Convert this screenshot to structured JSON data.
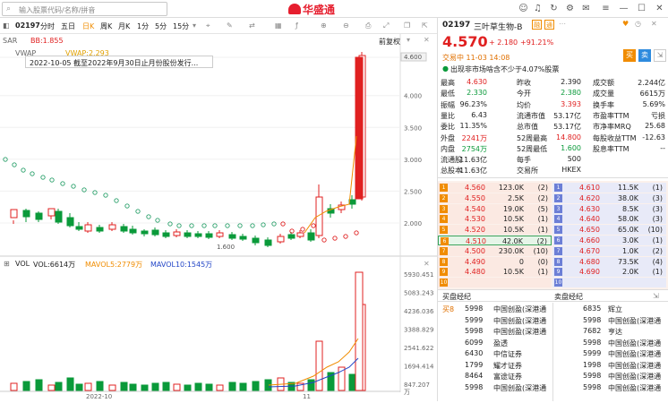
{
  "search": {
    "placeholder": "输入股票代码/名称/拼音"
  },
  "logo": {
    "text": "华盛通"
  },
  "tabs": {
    "code": "02197",
    "items": [
      "分时",
      "五日",
      "日K",
      "周K",
      "月K",
      "1分",
      "5分",
      "15分"
    ],
    "active": "日K",
    "adjust": "前复权"
  },
  "indicators": {
    "sar": "SAR",
    "bb": "BB:1.855",
    "vwap": "VWAP",
    "vwap_val": "VWAP:2.293"
  },
  "tooltip": "2022-10-05 截至2022年9月30日止月份股份发行...",
  "price_axis": {
    "labels": [
      "4.600",
      "4.000",
      "3.500",
      "3.000",
      "2.500",
      "2.000"
    ],
    "min_label": "1.600",
    "current": "4.600"
  },
  "vol_header": {
    "vol": "VOL",
    "vol_val": "VOL:6614万",
    "ma5": "MAVOL5:2779万",
    "ma10": "MAVOL10:1545万"
  },
  "vol_axis": {
    "labels": [
      "5930.451",
      "5083.243",
      "4236.036",
      "3388.829",
      "2541.622",
      "1694.414",
      "847.207",
      "万"
    ]
  },
  "date_axis": [
    "2022-10",
    "11"
  ],
  "stock": {
    "code": "02197",
    "name": "三叶草生物-B",
    "price": "4.570",
    "change": "+ 2.180",
    "pct": "+91.21%",
    "time": "交易中 11-03 14:08",
    "notice": "出现非市场啥含不少于4.07%股票"
  },
  "colors": {
    "up": "#e02020",
    "down": "#0a9a3a",
    "accent": "#f08c00",
    "blue": "#2346c7"
  },
  "fin": [
    [
      [
        "最高",
        "4.630",
        "red"
      ],
      [
        "昨收",
        "2.390",
        ""
      ],
      [
        "成交额",
        "2.244亿",
        ""
      ]
    ],
    [
      [
        "最低",
        "2.330",
        "green"
      ],
      [
        "今开",
        "2.380",
        "green"
      ],
      [
        "成交量",
        "6615万",
        ""
      ]
    ],
    [
      [
        "振幅",
        "96.23%",
        ""
      ],
      [
        "均价",
        "3.393",
        "red"
      ],
      [
        "换手率",
        "5.69%",
        ""
      ]
    ],
    [
      [
        "量比",
        "6.43",
        ""
      ],
      [
        "流通市值",
        "53.17亿",
        ""
      ],
      [
        "市盈率TTM",
        "亏损",
        ""
      ]
    ],
    [
      [
        "委比",
        "11.35%",
        ""
      ],
      [
        "总市值",
        "53.17亿",
        ""
      ],
      [
        "市净率MRQ",
        "25.68",
        ""
      ]
    ],
    [
      [
        "外盘",
        "2241万",
        "red"
      ],
      [
        "52周最高",
        "14.800",
        "red"
      ],
      [
        "每股收益TTM",
        "-12.63",
        ""
      ]
    ],
    [
      [
        "内盘",
        "2754万",
        "green"
      ],
      [
        "52周最低",
        "1.600",
        "green"
      ],
      [
        "股息率TTM",
        "--",
        ""
      ]
    ],
    [
      [
        "流通股",
        "11.63亿",
        ""
      ],
      [
        "每手",
        "500",
        ""
      ],
      [
        "",
        ""
      ]
    ],
    [
      [
        "总股本",
        "11.63亿",
        ""
      ],
      [
        "交易所",
        "HKEX",
        ""
      ],
      [
        "",
        ""
      ]
    ]
  ],
  "bids": [
    [
      "1",
      "4.560",
      "123.0K",
      "(2)"
    ],
    [
      "2",
      "4.550",
      "2.5K",
      "(2)"
    ],
    [
      "3",
      "4.540",
      "19.0K",
      "(5)"
    ],
    [
      "4",
      "4.530",
      "10.5K",
      "(1)"
    ],
    [
      "5",
      "4.520",
      "10.5K",
      "(1)"
    ],
    [
      "6",
      "4.510",
      "42.0K",
      "(2)"
    ],
    [
      "7",
      "4.500",
      "230.0K",
      "(10)"
    ],
    [
      "8",
      "4.490",
      "0",
      "(0)"
    ],
    [
      "9",
      "4.480",
      "10.5K",
      "(1)"
    ],
    [
      "10",
      "",
      "",
      " "
    ]
  ],
  "asks": [
    [
      "1",
      "4.610",
      "11.5K",
      "(1)"
    ],
    [
      "2",
      "4.620",
      "38.0K",
      "(3)"
    ],
    [
      "3",
      "4.630",
      "8.5K",
      "(3)"
    ],
    [
      "4",
      "4.640",
      "58.0K",
      "(3)"
    ],
    [
      "5",
      "4.650",
      "65.0K",
      "(10)"
    ],
    [
      "6",
      "4.660",
      "3.0K",
      "(1)"
    ],
    [
      "7",
      "4.670",
      "1.0K",
      "(2)"
    ],
    [
      "8",
      "4.680",
      "73.5K",
      "(4)"
    ],
    [
      "9",
      "4.690",
      "2.0K",
      "(1)"
    ],
    [
      "10",
      "",
      "",
      ""
    ]
  ],
  "brokers": {
    "buy_title": "买盘经纪",
    "sell_title": "卖盘经纪",
    "buy_label": "买8",
    "buy": [
      [
        "5998",
        "中国创盈(深港通"
      ],
      [
        "5999",
        "中国创盈(深港通"
      ],
      [
        "5998",
        "中国创盈(深港通"
      ],
      [
        "6099",
        "盈透"
      ],
      [
        "6430",
        "中信证券"
      ],
      [
        "1799",
        "耀才证券"
      ],
      [
        "8464",
        "富途证券"
      ],
      [
        "5998",
        "中国创盈(深港通"
      ]
    ],
    "sell": [
      [
        "6835",
        "辉立"
      ],
      [
        "5998",
        "中国创盈(深港通"
      ],
      [
        "7682",
        "亨达"
      ],
      [
        "5998",
        "中国创盈(深港通"
      ],
      [
        "5999",
        "中国创盈(深港通"
      ],
      [
        "1998",
        "中国创盈(深港通"
      ],
      [
        "5998",
        "中国创盈(深港通"
      ],
      [
        "5998",
        "中国创盈(深港通"
      ]
    ]
  }
}
